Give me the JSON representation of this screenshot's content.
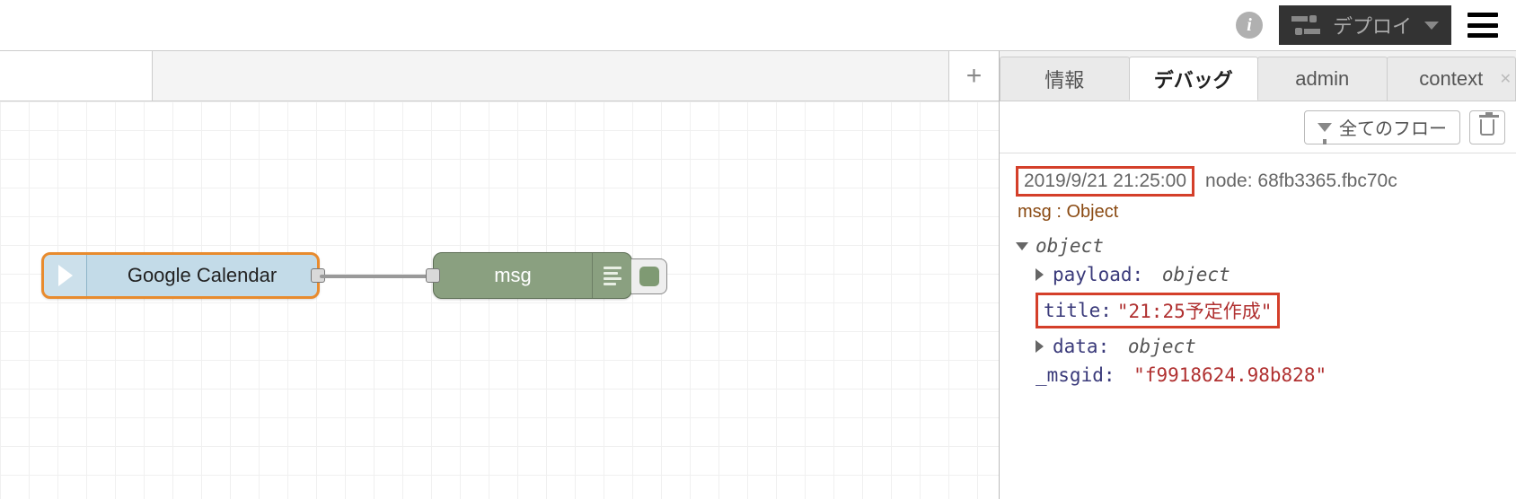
{
  "header": {
    "deploy_label": "デプロイ"
  },
  "workspace": {
    "nodes": {
      "gcal": {
        "label": "Google Calendar"
      },
      "debug": {
        "label": "msg"
      }
    }
  },
  "sidebar": {
    "tabs": {
      "info": "情報",
      "debug": "デバッグ",
      "admin": "admin",
      "context": "context"
    },
    "toolbar": {
      "filter_label": "全てのフロー"
    },
    "message": {
      "timestamp": "2019/9/21 21:25:00",
      "node_label_prefix": "node: ",
      "node_id": "68fb3365.fbc70c",
      "type": "msg : Object",
      "root_label": "object",
      "payload_key": "payload",
      "payload_type": "object",
      "title_key": "title",
      "title_value": "\"21:25予定作成\"",
      "data_key": "data",
      "data_type": "object",
      "msgid_key": "_msgid",
      "msgid_value": "\"f9918624.98b828\""
    }
  }
}
